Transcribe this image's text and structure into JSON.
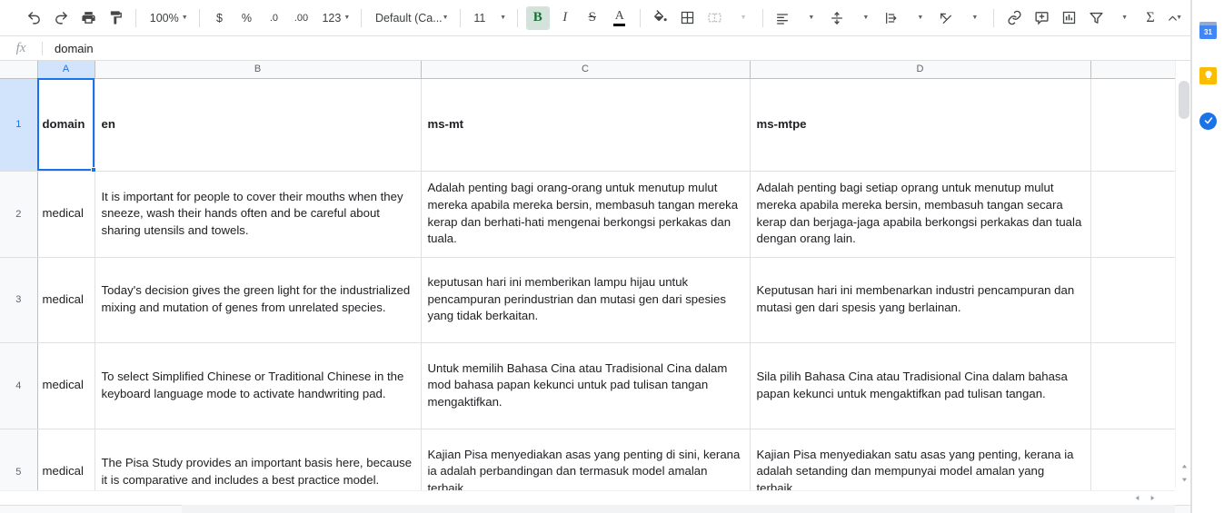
{
  "toolbar": {
    "undo_label": "undo-icon",
    "redo_label": "redo-icon",
    "print_label": "print-icon",
    "paint_label": "paint-format-icon",
    "zoom_value": "100%",
    "currency_label": "$",
    "percent_label": "%",
    "dec_decrease_label": ".0",
    "dec_increase_label": ".00",
    "number_format_label": "123",
    "font_name": "Default (Ca...",
    "font_size": "11",
    "bold_label": "B",
    "italic_label": "I",
    "strikethrough_label": "S",
    "text_color_label": "A",
    "fill_color_label": "fill-color-icon",
    "borders_label": "borders-icon",
    "merge_label": "merge-cells-icon",
    "halign_label": "horizontal-align-icon",
    "valign_label": "vertical-align-icon",
    "wrap_label": "text-wrap-icon",
    "rotate_label": "text-rotation-icon",
    "link_label": "insert-link-icon",
    "comment_label": "insert-comment-icon",
    "chart_label": "insert-chart-icon",
    "filter_label": "filter-icon",
    "functions_label": "Σ",
    "collapse_label": "⌃"
  },
  "formula_bar": {
    "fx_label": "fx",
    "value": "domain",
    "placeholder": ""
  },
  "sheet": {
    "column_headers": [
      "A",
      "B",
      "C",
      "D"
    ],
    "active_cell": "A1",
    "row_numbers": [
      "1",
      "2",
      "3",
      "4",
      "5"
    ],
    "rows": [
      {
        "num": "1",
        "a": "domain",
        "b": "en",
        "c": "ms-mt",
        "d": "ms-mtpe",
        "bold": true
      },
      {
        "num": "2",
        "a": "medical",
        "b": "It is important for people to cover their mouths when they sneeze, wash their hands often and be careful about sharing utensils and towels.",
        "c": "Adalah penting bagi orang-orang untuk menutup mulut mereka apabila mereka bersin, membasuh tangan mereka kerap dan berhati-hati mengenai berkongsi perkakas dan tuala.",
        "d": "Adalah penting bagi setiap oprang untuk menutup mulut mereka apabila mereka bersin, membasuh tangan secara kerap dan berjaga-jaga apabila berkongsi perkakas dan tuala dengan orang lain.",
        "bold": false
      },
      {
        "num": "3",
        "a": "medical",
        "b": "Today's decision gives the green light for the industrialized mixing and mutation of genes from unrelated species.",
        "c": "keputusan hari ini memberikan lampu hijau untuk pencampuran perindustrian dan mutasi gen dari spesies yang tidak berkaitan.",
        "d": "Keputusan hari ini membenarkan industri pencampuran dan mutasi gen dari spesis yang berlainan.",
        "bold": false
      },
      {
        "num": "4",
        "a": "medical",
        "b": "To select Simplified Chinese or Traditional Chinese in the keyboard language mode to activate handwriting pad.",
        "c": "Untuk memilih Bahasa Cina atau Tradisional Cina dalam mod bahasa papan kekunci untuk pad tulisan tangan mengaktifkan.",
        "d": "Sila pilih Bahasa Cina atau Tradisional Cina dalam bahasa papan kekunci untuk mengaktifkan pad tulisan tangan.",
        "bold": false
      },
      {
        "num": "5",
        "a": "medical",
        "b": "The Pisa Study provides an important basis here, because it is comparative and includes a best practice model.",
        "c": "Kajian Pisa menyediakan asas yang penting di sini, kerana ia adalah perbandingan dan termasuk model amalan terbaik.",
        "d": "Kajian Pisa menyediakan satu asas yang penting, kerana ia adalah setanding dan mempunyai model amalan yang terbaik.",
        "bold": false
      }
    ]
  },
  "side_panel": {
    "calendar_label": "31",
    "keep_label": "keep-icon",
    "tasks_label": "tasks-icon"
  },
  "colors": {
    "accent": "#1a73e8",
    "bold_active_bg": "#d3e3dc",
    "bold_active_fg": "#137333",
    "header_bg": "#f8f9fa",
    "grid_line": "#e0e0e0"
  }
}
